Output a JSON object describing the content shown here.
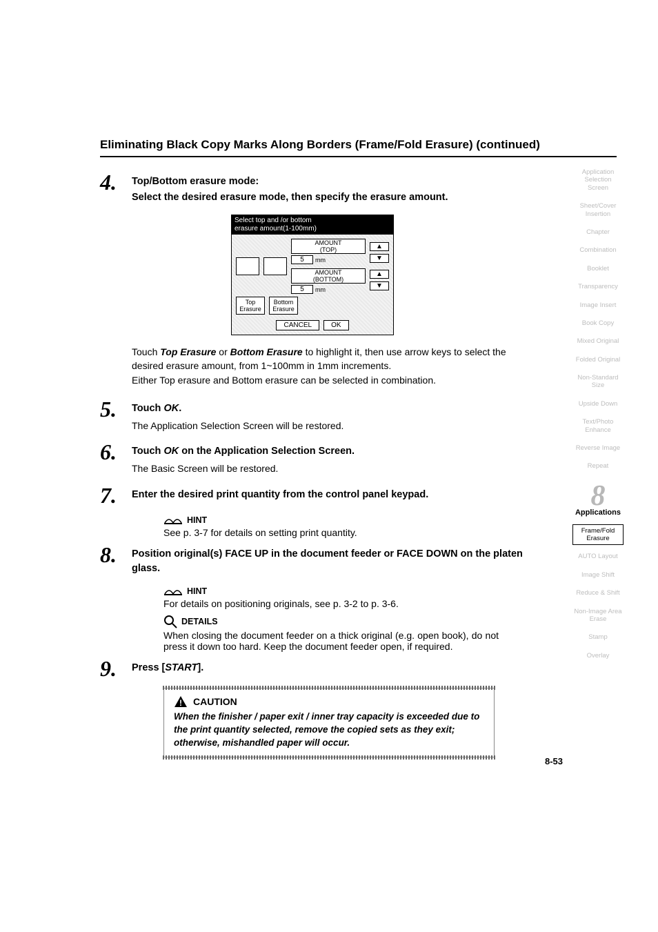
{
  "title": "Eliminating Black Copy Marks Along Borders (Frame/Fold Erasure) (continued)",
  "steps": {
    "s4": {
      "num": "4.",
      "head1": "Top/Bottom erasure mode:",
      "head2": "Select the desired erasure mode, then specify the erasure amount.",
      "figure": {
        "header1": "Select top and /or bottom",
        "header2": "erasure amount(1-100mm)",
        "amount_top_label": "AMOUNT\n(TOP)",
        "amount_bottom_label": "AMOUNT\n(BOTTOM)",
        "top_val": "5",
        "bottom_val": "5",
        "unit": "mm",
        "up": "▲",
        "down": "▼",
        "tab_top": "Top\nErasure",
        "tab_bottom": "Bottom\nErasure",
        "cancel": "CANCEL",
        "ok": "OK"
      },
      "para1a": "Touch ",
      "para1b": "Top Erasure",
      "para1c": " or ",
      "para1d": "Bottom Erasure",
      "para1e": " to highlight it, then use arrow keys to select the desired erasure amount, from 1~100mm in 1mm increments.",
      "para2": "Either Top erasure and Bottom erasure can be selected in combination."
    },
    "s5": {
      "num": "5.",
      "head_a": "Touch ",
      "head_b": "OK",
      "head_c": ".",
      "sub": "The Application Selection Screen will be restored."
    },
    "s6": {
      "num": "6.",
      "head_a": "Touch ",
      "head_b": "OK",
      "head_c": " on the Application Selection Screen.",
      "sub": "The Basic Screen will be restored."
    },
    "s7": {
      "num": "7.",
      "head": "Enter the desired print quantity from the control panel keypad.",
      "hint_label": "HINT",
      "hint_text": "See p. 3-7 for details on setting print quantity."
    },
    "s8": {
      "num": "8.",
      "head": "Position original(s) FACE UP in the document feeder or FACE DOWN on the platen glass.",
      "hint_label": "HINT",
      "hint_text": "For details on positioning originals, see p. 3-2 to p. 3-6.",
      "details_label": "DETAILS",
      "details_text": "When closing the document feeder on a thick original (e.g. open book), do not press it down too hard. Keep the document feeder open, if required."
    },
    "s9": {
      "num": "9.",
      "head_a": "Press [",
      "head_b": "START",
      "head_c": "].",
      "caution_label": "CAUTION",
      "caution_text": "When the finisher / paper exit / inner tray capacity is exceeded due to the print quantity selected, remove the copied sets as they exit; otherwise, mishandled paper will occur."
    }
  },
  "sidebar": {
    "items": [
      "Application Selection Screen",
      "Sheet/Cover Insertion",
      "Chapter",
      "Combination",
      "Booklet",
      "Transparency",
      "Image Insert",
      "Book Copy",
      "Mixed Original",
      "Folded Original",
      "Non-Standard Size",
      "Upside Down",
      "Text/Photo Enhance",
      "Reverse Image",
      "Repeat"
    ],
    "chapter_num": "8",
    "chapter_label": "Applications",
    "items2": [
      "Frame/Fold Erasure",
      "AUTO Layout",
      "Image Shift",
      "Reduce & Shift",
      "Non-Image Area Erase",
      "Stamp",
      "Overlay"
    ],
    "active_index2": 0
  },
  "page_number": "8-53"
}
